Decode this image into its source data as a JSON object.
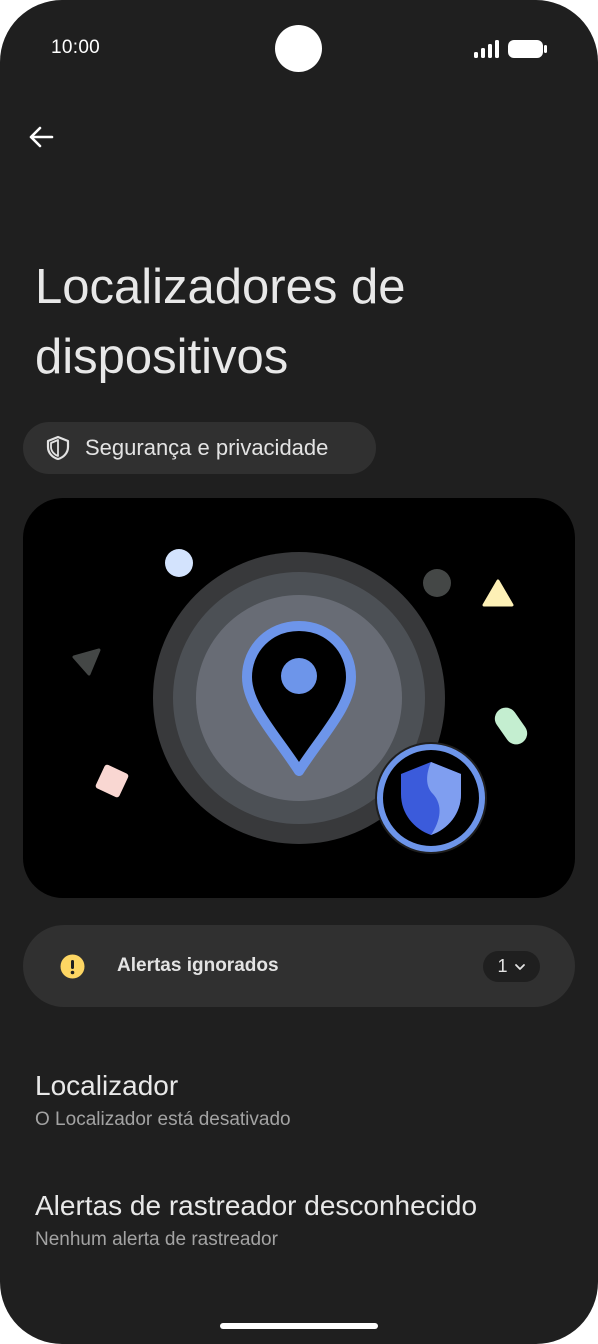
{
  "status_bar": {
    "time": "10:00"
  },
  "header": {
    "title": "Localizadores de dispositivos"
  },
  "chip": {
    "label": "Segurança e privacidade",
    "icon": "shield-outline-icon"
  },
  "hero": {
    "icons": [
      "location-pin-icon",
      "shield-badge-icon"
    ]
  },
  "alerts": {
    "label": "Alertas ignorados",
    "count": "1",
    "icon": "warning-icon"
  },
  "list": [
    {
      "title": "Localizador",
      "subtitle": "O Localizador está desativado"
    },
    {
      "title": "Alertas de rastreador desconhecido",
      "subtitle": "Nenhum alerta de rastreador"
    }
  ],
  "colors": {
    "background": "#1f1f1f",
    "surface": "#303030",
    "accent_blue": "#6d95ea",
    "warning_yellow": "#fdd663"
  }
}
